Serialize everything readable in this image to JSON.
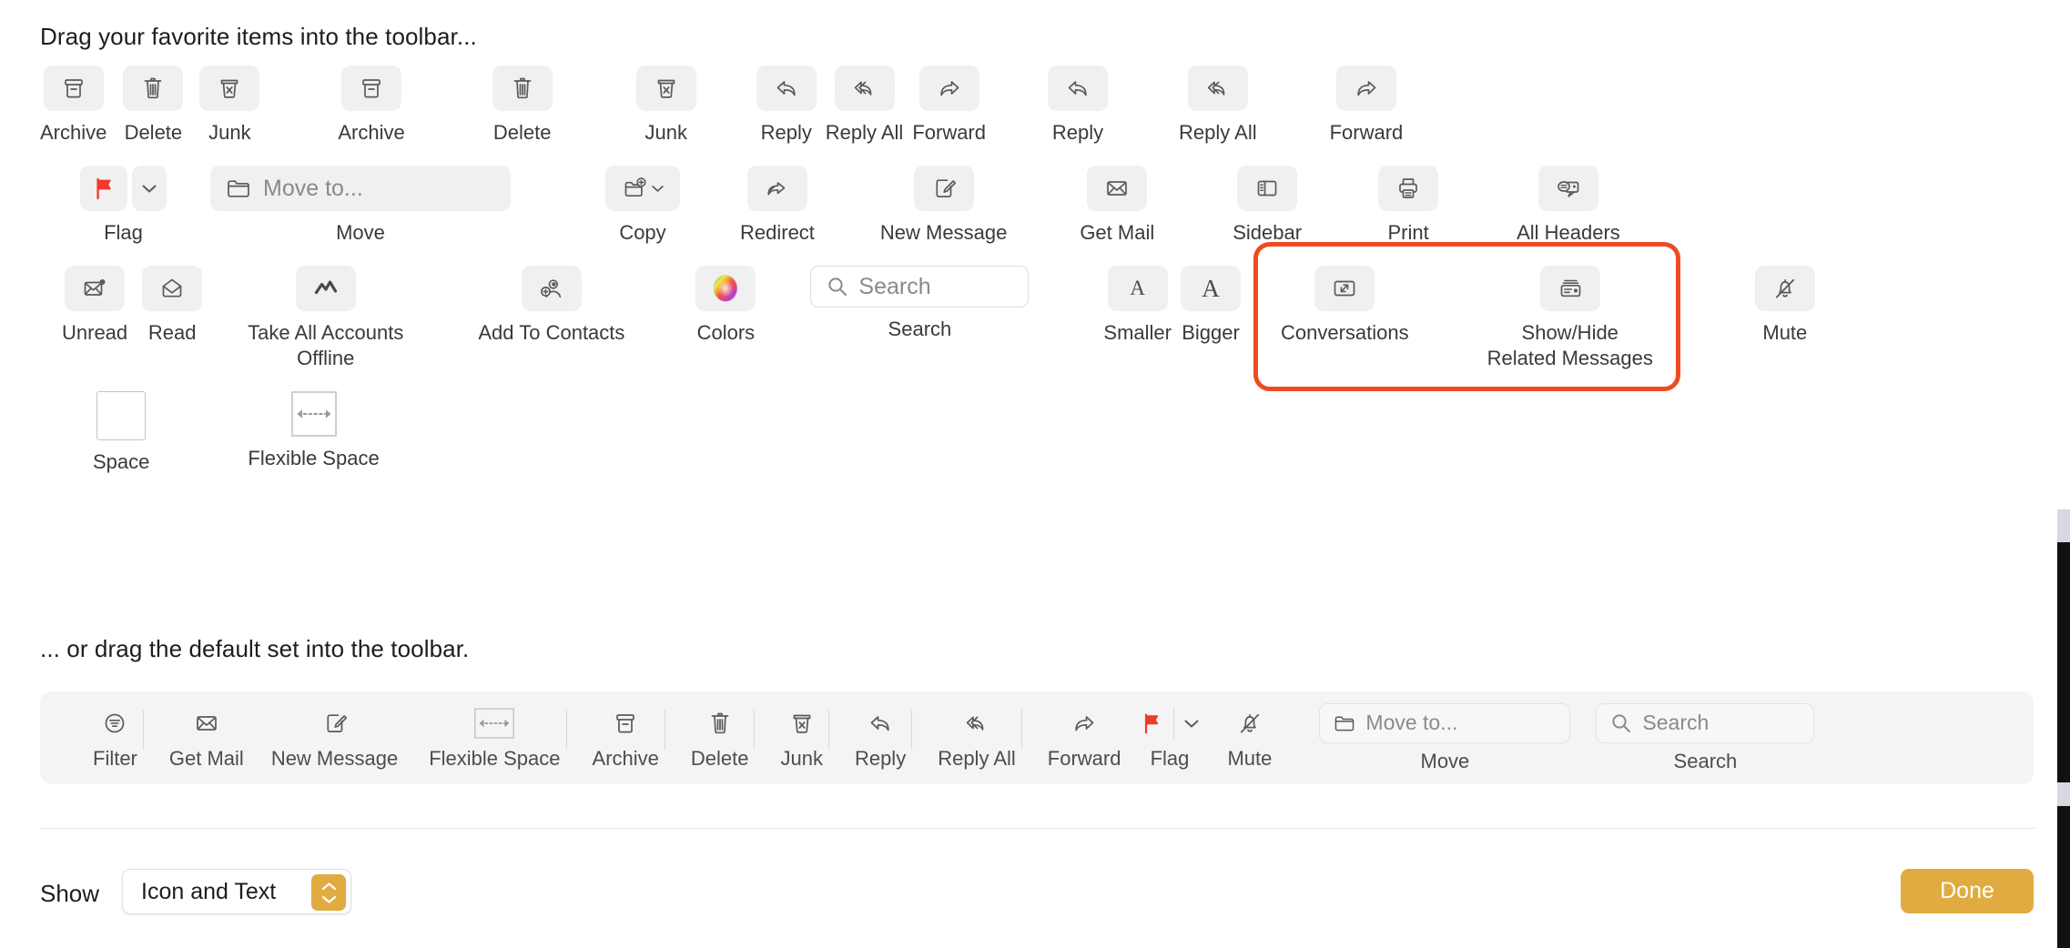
{
  "headings": {
    "drag_favorites": "Drag your favorite items into the toolbar...",
    "drag_default": "... or drag the default set into the toolbar."
  },
  "palette": {
    "rows": [
      {
        "items": [
          {
            "label": "Archive",
            "icon": "archive-icon"
          },
          {
            "label": "Delete",
            "icon": "trash-icon"
          },
          {
            "label": "Junk",
            "icon": "junk-icon"
          },
          {
            "label": "Archive",
            "icon": "archive-icon"
          },
          {
            "label": "Delete",
            "icon": "trash-icon"
          },
          {
            "label": "Junk",
            "icon": "junk-icon"
          },
          {
            "label": "Reply",
            "icon": "reply-icon"
          },
          {
            "label": "Reply All",
            "icon": "reply-all-icon"
          },
          {
            "label": "Forward",
            "icon": "forward-icon"
          },
          {
            "label": "Reply",
            "icon": "reply-icon"
          },
          {
            "label": "Reply All",
            "icon": "reply-all-icon"
          },
          {
            "label": "Forward",
            "icon": "forward-icon"
          }
        ]
      },
      {
        "items": [
          {
            "label": "Flag",
            "icon": "flag-icon"
          },
          {
            "label": "Move",
            "icon": "folder-icon",
            "field_text": "Move to..."
          },
          {
            "label": "Copy",
            "icon": "copy-folder-icon"
          },
          {
            "label": "Redirect",
            "icon": "redirect-icon"
          },
          {
            "label": "New Message",
            "icon": "compose-icon"
          },
          {
            "label": "Get Mail",
            "icon": "envelope-icon"
          },
          {
            "label": "Sidebar",
            "icon": "sidebar-icon"
          },
          {
            "label": "Print",
            "icon": "printer-icon"
          },
          {
            "label": "All Headers",
            "icon": "all-headers-icon"
          }
        ]
      },
      {
        "items": [
          {
            "label": "Unread",
            "icon": "unread-envelope-icon"
          },
          {
            "label": "Read",
            "icon": "read-envelope-icon"
          },
          {
            "label": "Take All Accounts\nOffline",
            "icon": "offline-icon"
          },
          {
            "label": "Add To Contacts",
            "icon": "add-contact-icon"
          },
          {
            "label": "Colors",
            "icon": "color-wheel-icon"
          },
          {
            "label": "Search",
            "icon": "search-icon",
            "field_text": "Search"
          },
          {
            "label": "Smaller",
            "icon": "letter-a-small-icon"
          },
          {
            "label": "Bigger",
            "icon": "letter-a-big-icon"
          },
          {
            "label": "Conversations",
            "icon": "conversations-icon"
          },
          {
            "label": "Show/Hide\nRelated Messages",
            "icon": "related-messages-icon"
          },
          {
            "label": "Mute",
            "icon": "mute-bell-icon"
          }
        ]
      },
      {
        "items": [
          {
            "label": "Space",
            "icon": "space-box-icon"
          },
          {
            "label": "Flexible Space",
            "icon": "flexible-space-icon"
          }
        ]
      }
    ]
  },
  "highlight": {
    "color": "#f04a23",
    "items": [
      "Conversations",
      "Show/Hide Related Messages"
    ]
  },
  "default_set": {
    "items": [
      {
        "label": "Filter",
        "icon": "filter-icon",
        "separator_after": true
      },
      {
        "label": "Get Mail",
        "icon": "envelope-icon"
      },
      {
        "label": "New Message",
        "icon": "compose-icon"
      },
      {
        "label": "Flexible Space",
        "icon": "flexible-space-icon"
      },
      {
        "label": "Archive",
        "icon": "archive-icon",
        "separator_before": true
      },
      {
        "label": "Delete",
        "icon": "trash-icon",
        "separator_before": true
      },
      {
        "label": "Junk",
        "icon": "junk-icon",
        "separator_before": true
      },
      {
        "label": "Reply",
        "icon": "reply-icon",
        "separator_before": true
      },
      {
        "label": "Reply All",
        "icon": "reply-all-icon",
        "separator_before": true
      },
      {
        "label": "Forward",
        "icon": "forward-icon",
        "separator_before": true
      },
      {
        "label": "Flag",
        "icon": "flag-icon"
      },
      {
        "label": "Mute",
        "icon": "mute-bell-icon"
      },
      {
        "label": "Move",
        "icon": "folder-icon",
        "field_text": "Move to..."
      },
      {
        "label": "Search",
        "icon": "search-icon",
        "field_text": "Search"
      }
    ]
  },
  "footer": {
    "show_label": "Show",
    "show_value": "Icon and Text",
    "done_label": "Done",
    "accent_color": "#e0ab40"
  }
}
